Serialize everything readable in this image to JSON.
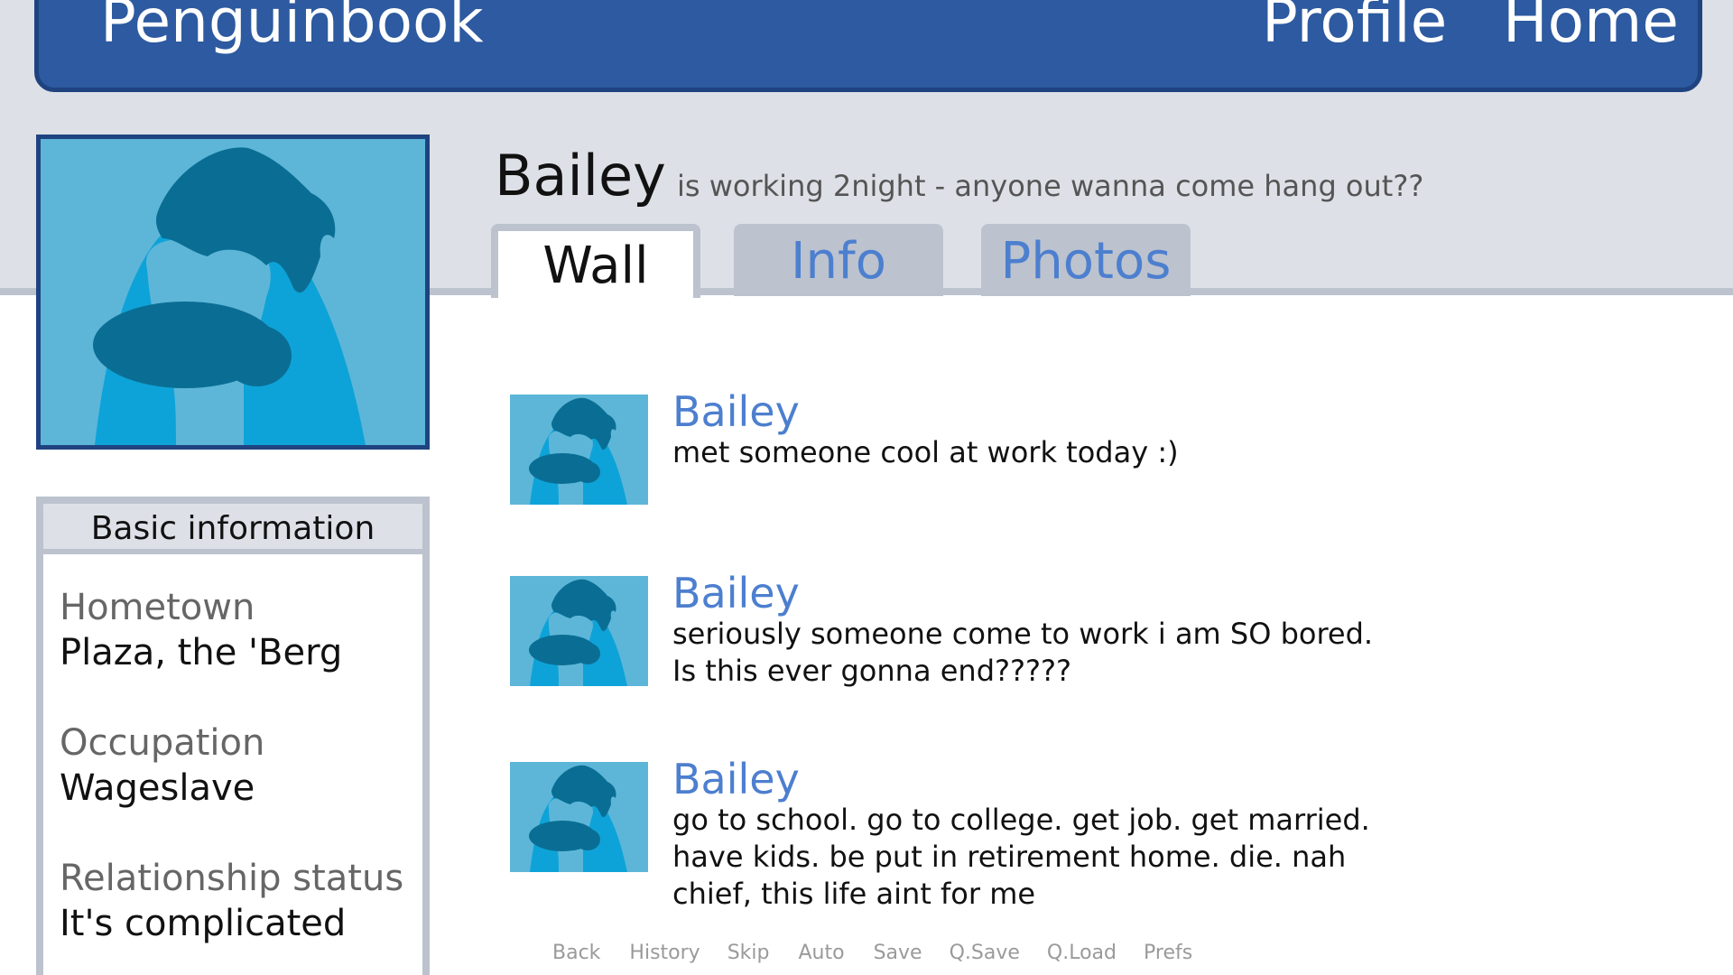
{
  "header": {
    "brand": "Penguinbook",
    "nav": [
      "Profile",
      "Home"
    ]
  },
  "profile": {
    "name": "Bailey",
    "status": "is working 2night - anyone wanna come hang out??",
    "tabs": [
      {
        "label": "Wall",
        "active": true
      },
      {
        "label": "Info",
        "active": false
      },
      {
        "label": "Photos",
        "active": false
      }
    ]
  },
  "basic_info": {
    "title": "Basic information",
    "fields": [
      {
        "label": "Hometown",
        "value": "Plaza, the 'Berg"
      },
      {
        "label": "Occupation",
        "value": "Wageslave"
      },
      {
        "label": "Relationship status",
        "value": "It's complicated"
      }
    ]
  },
  "wall": {
    "posts": [
      {
        "author": "Bailey",
        "lines": [
          "met someone cool at work today :)"
        ]
      },
      {
        "author": "Bailey",
        "lines": [
          "seriously someone come to work i am SO bored.",
          "Is this ever gonna end?????"
        ]
      },
      {
        "author": "Bailey",
        "lines": [
          "go to school. go to college. get job. get married.",
          "have kids. be put in retirement home. die. nah",
          "chief, this life aint for me"
        ]
      }
    ]
  },
  "quick_menu": [
    "Back",
    "History",
    "Skip",
    "Auto",
    "Save",
    "Q.Save",
    "Q.Load",
    "Prefs"
  ],
  "colors": {
    "header_blue": "#2d5aa0",
    "link_blue": "#4d7fcf",
    "avatar_bg": "#5db6d8",
    "avatar_body": "#0ea3d8",
    "avatar_dark": "#0a6e94",
    "panel_gray": "#dde0e6",
    "border_gray": "#bcc3ce"
  }
}
